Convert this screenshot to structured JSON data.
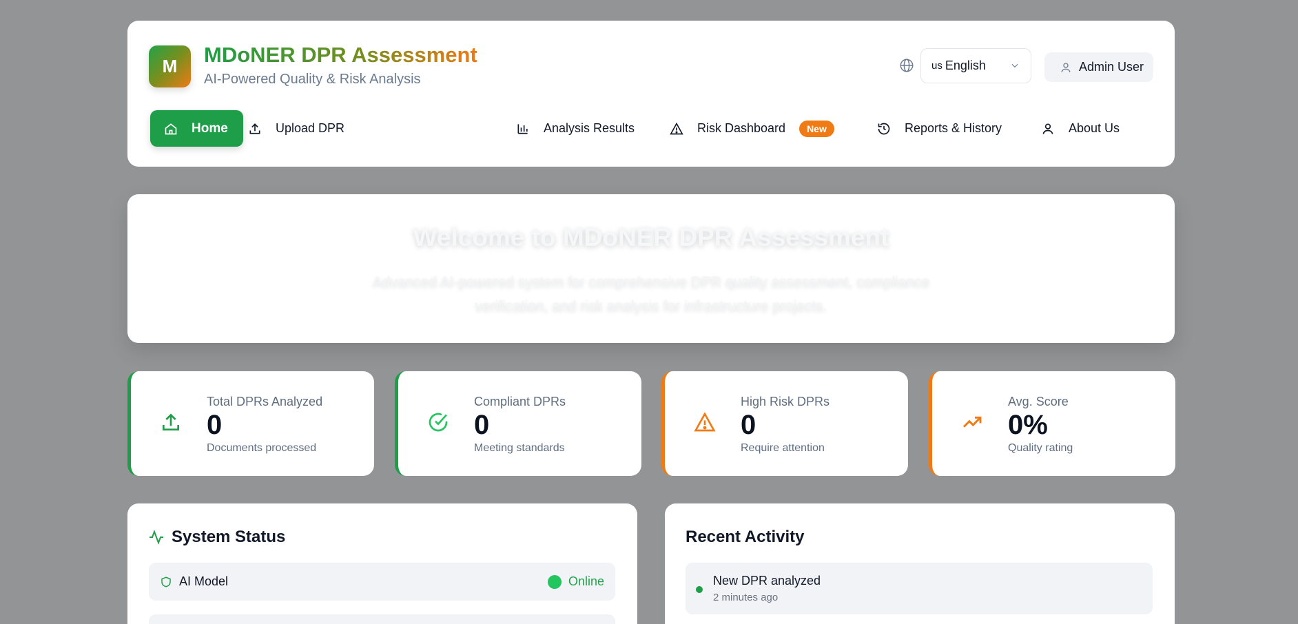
{
  "app": {
    "logo_letter": "M",
    "title": "MDoNER DPR Assessment",
    "subtitle": "AI-Powered Quality & Risk Analysis"
  },
  "header": {
    "language": {
      "flag": "us",
      "selected": "English"
    },
    "user_label": "Admin User"
  },
  "nav": {
    "items": [
      {
        "label": "Home",
        "icon": "home-icon",
        "active": true
      },
      {
        "label": "Upload DPR",
        "icon": "upload-icon"
      },
      {
        "label": "Analysis Results",
        "icon": "bar-chart-icon"
      },
      {
        "label": "Risk Dashboard",
        "icon": "warning-icon",
        "badge": "New"
      },
      {
        "label": "Reports & History",
        "icon": "history-icon"
      },
      {
        "label": "About Us",
        "icon": "user-icon"
      }
    ]
  },
  "hero": {
    "title": "Welcome to MDoNER DPR Assessment",
    "text": "Advanced AI-powered system for comprehensive DPR quality assessment, compliance verification, and risk analysis for infrastructure projects."
  },
  "stats": [
    {
      "label": "Total DPRs Analyzed",
      "value": "0",
      "sub": "Documents processed",
      "icon": "upload-icon",
      "color": "#1e9e48"
    },
    {
      "label": "Compliant DPRs",
      "value": "0",
      "sub": "Meeting standards",
      "icon": "check-circle-icon",
      "color": "#22c55e"
    },
    {
      "label": "High Risk DPRs",
      "value": "0",
      "sub": "Require attention",
      "icon": "warning-icon",
      "color": "#f07a14"
    },
    {
      "label": "Avg. Score",
      "value": "0%",
      "sub": "Quality rating",
      "icon": "trending-up-icon",
      "color": "#f07a14"
    }
  ],
  "system_status": {
    "title": "System Status",
    "rows": [
      {
        "label": "AI Model",
        "state": "Online"
      }
    ]
  },
  "recent_activity": {
    "title": "Recent Activity",
    "items": [
      {
        "text": "New DPR analyzed",
        "time": "2 minutes ago"
      }
    ]
  },
  "colors": {
    "brand_green": "#1e9e48",
    "brand_orange": "#f07a14",
    "background": "#939496"
  }
}
